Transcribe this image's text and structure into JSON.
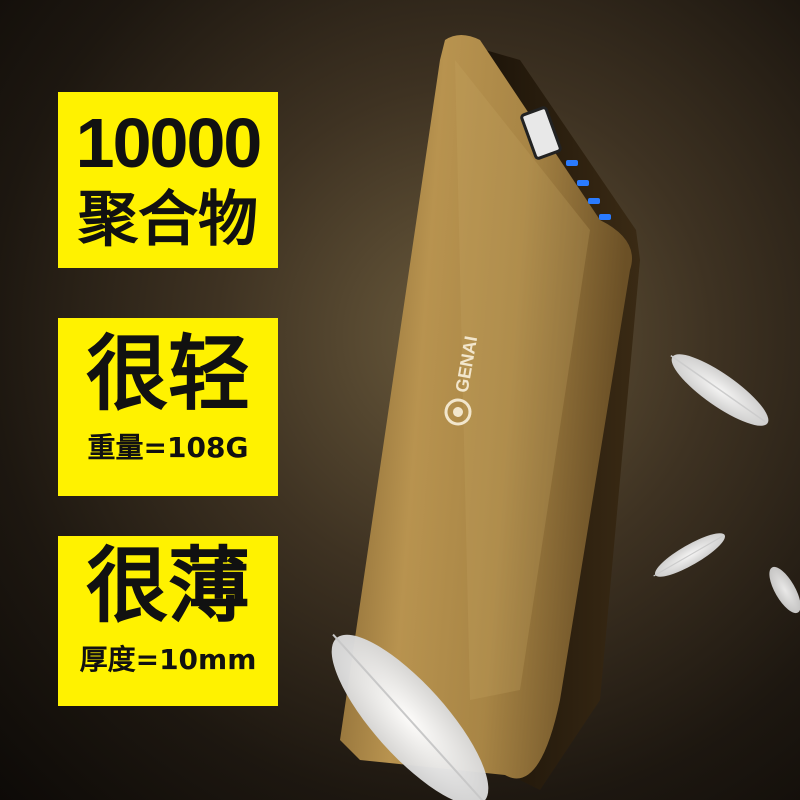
{
  "badge1": {
    "number": "10000",
    "label": "聚合物"
  },
  "badge2": {
    "title": "很轻",
    "spec": "重量=108G"
  },
  "badge3": {
    "title": "很薄",
    "spec": "厚度=10mm"
  },
  "product": {
    "brand_logo": "GENAI"
  },
  "colors": {
    "badge_yellow": "#fff200",
    "body_gold": "#b08a4a",
    "led_blue": "#2a7bff"
  }
}
